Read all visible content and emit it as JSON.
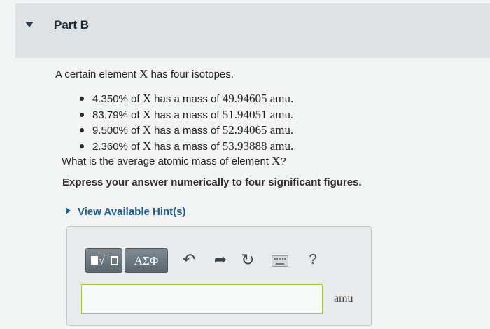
{
  "part": {
    "title": "Part B"
  },
  "problem": {
    "intro_prefix": "A certain element ",
    "element_symbol": "X",
    "intro_suffix": " has four isotopes.",
    "isotopes": [
      {
        "percent": "4.350%",
        "of": " of ",
        "symbol": "X",
        "has": " has a mass of ",
        "mass": "49.94605 amu."
      },
      {
        "percent": "83.79%",
        "of": " of ",
        "symbol": "X",
        "has": " has a mass of ",
        "mass": "51.94051 amu."
      },
      {
        "percent": "9.500%",
        "of": " of ",
        "symbol": "X",
        "has": " has a mass of ",
        "mass": "52.94065 amu."
      },
      {
        "percent": "2.360%",
        "of": " of ",
        "symbol": "X",
        "has": " has a mass of ",
        "mass": "53.93888 amu."
      }
    ],
    "question_prefix": "What is the average atomic mass of element ",
    "question_symbol": "X",
    "question_suffix": "?",
    "instruction": "Express your answer numerically to four significant figures."
  },
  "hints": {
    "label": "View Available Hint(s)"
  },
  "toolbar": {
    "templates_sqrt": "√",
    "symbols_label": "ΑΣΦ",
    "undo_icon": "undo-icon",
    "redo_icon": "redo-icon",
    "reset_icon": "reset-icon",
    "keyboard_icon": "keyboard-icon",
    "help_label": "?"
  },
  "answer": {
    "value": "",
    "unit": "amu"
  },
  "colors": {
    "header_bg": "#dfe2e4",
    "link": "#1d5c8c",
    "input_border": "#a8c44a"
  }
}
